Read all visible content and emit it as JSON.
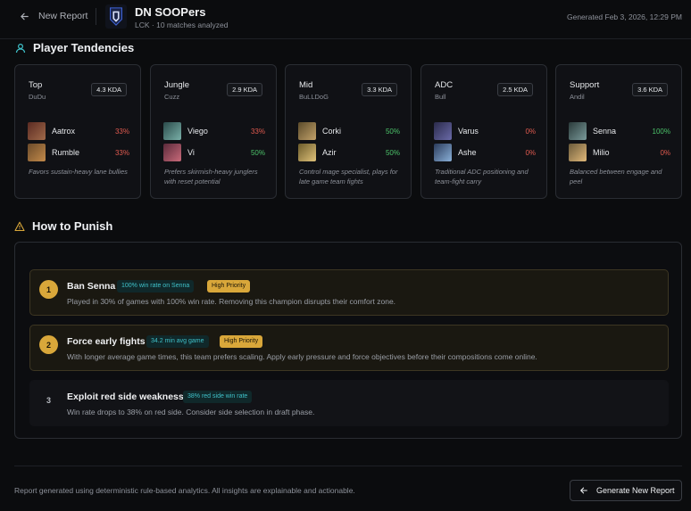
{
  "header": {
    "back_label": "New Report",
    "team_name": "DN SOOPers",
    "team_subtitle": "LCK · 10 matches analyzed",
    "generated": "Generated Feb 3, 2026, 12:29 PM"
  },
  "tendencies": {
    "title": "Player Tendencies",
    "cards": [
      {
        "role": "Top",
        "player": "DuDu",
        "kda": "4.3 KDA",
        "champions": [
          {
            "name": "Aatrox",
            "winrate": "33%",
            "wr_color": "#e05a4f",
            "img_colors": [
              "#5a2a22",
              "#a06a4a"
            ]
          },
          {
            "name": "Rumble",
            "winrate": "33%",
            "wr_color": "#e05a4f",
            "img_colors": [
              "#6a4a2a",
              "#c28a4a"
            ]
          }
        ],
        "note": "Favors sustain-heavy lane bullies"
      },
      {
        "role": "Jungle",
        "player": "Cuzz",
        "kda": "2.9 KDA",
        "champions": [
          {
            "name": "Viego",
            "winrate": "33%",
            "wr_color": "#e05a4f",
            "img_colors": [
              "#2a4a4a",
              "#7ab0a8"
            ]
          },
          {
            "name": "Vi",
            "winrate": "50%",
            "wr_color": "#4cc36a",
            "img_colors": [
              "#5a2a3a",
              "#c86a7a"
            ]
          }
        ],
        "note": "Prefers skirmish-heavy junglers with reset potential"
      },
      {
        "role": "Mid",
        "player": "BuLLDoG",
        "kda": "3.3 KDA",
        "champions": [
          {
            "name": "Corki",
            "winrate": "50%",
            "wr_color": "#4cc36a",
            "img_colors": [
              "#5a4a2a",
              "#c2a26a"
            ]
          },
          {
            "name": "Azir",
            "winrate": "50%",
            "wr_color": "#4cc36a",
            "img_colors": [
              "#6a5a2a",
              "#e0c27a"
            ]
          }
        ],
        "note": "Control mage specialist, plays for late game team fights"
      },
      {
        "role": "ADC",
        "player": "Bull",
        "kda": "2.5 KDA",
        "champions": [
          {
            "name": "Varus",
            "winrate": "0%",
            "wr_color": "#e05a4f",
            "img_colors": [
              "#2a2a4a",
              "#6a6aa8"
            ]
          },
          {
            "name": "Ashe",
            "winrate": "0%",
            "wr_color": "#e05a4f",
            "img_colors": [
              "#2a3a5a",
              "#8ab0d8"
            ]
          }
        ],
        "note": "Traditional ADC positioning and team-fight carry"
      },
      {
        "role": "Support",
        "player": "Andil",
        "kda": "3.6 KDA",
        "champions": [
          {
            "name": "Senna",
            "winrate": "100%",
            "wr_color": "#4cc36a",
            "img_colors": [
              "#2a3a3a",
              "#7a9a9a"
            ]
          },
          {
            "name": "Milio",
            "winrate": "0%",
            "wr_color": "#e05a4f",
            "img_colors": [
              "#6a5a3a",
              "#e0b87a"
            ]
          }
        ],
        "note": "Balanced between engage and peel"
      }
    ]
  },
  "punish": {
    "title": "How to Punish",
    "items": [
      {
        "number": "1",
        "title": "Ban Senna",
        "stat_tag": "100% win rate on Senna",
        "priority": "High Priority",
        "description": "Played in 30% of games with 100% win rate. Removing this champion disrupts their comfort zone."
      },
      {
        "number": "2",
        "title": "Force early fights",
        "stat_tag": "34.2 min avg game",
        "priority": "High Priority",
        "description": "With longer average game times, this team prefers scaling. Apply early pressure and force objectives before their compositions come online."
      },
      {
        "number": "3",
        "title": "Exploit red side weakness",
        "stat_tag": "38% red side win rate",
        "priority": "",
        "description": "Win rate drops to 38% on red side. Consider side selection in draft phase."
      }
    ]
  },
  "footer": {
    "text": "Report generated using deterministic rule-based analytics. All insights are explainable and actionable.",
    "button_label": "Generate New Report"
  },
  "colors": {
    "accent_teal": "#3fc1c9",
    "priority_gold": "#d9a73a",
    "win": "#4cc36a",
    "loss": "#e05a4f"
  }
}
